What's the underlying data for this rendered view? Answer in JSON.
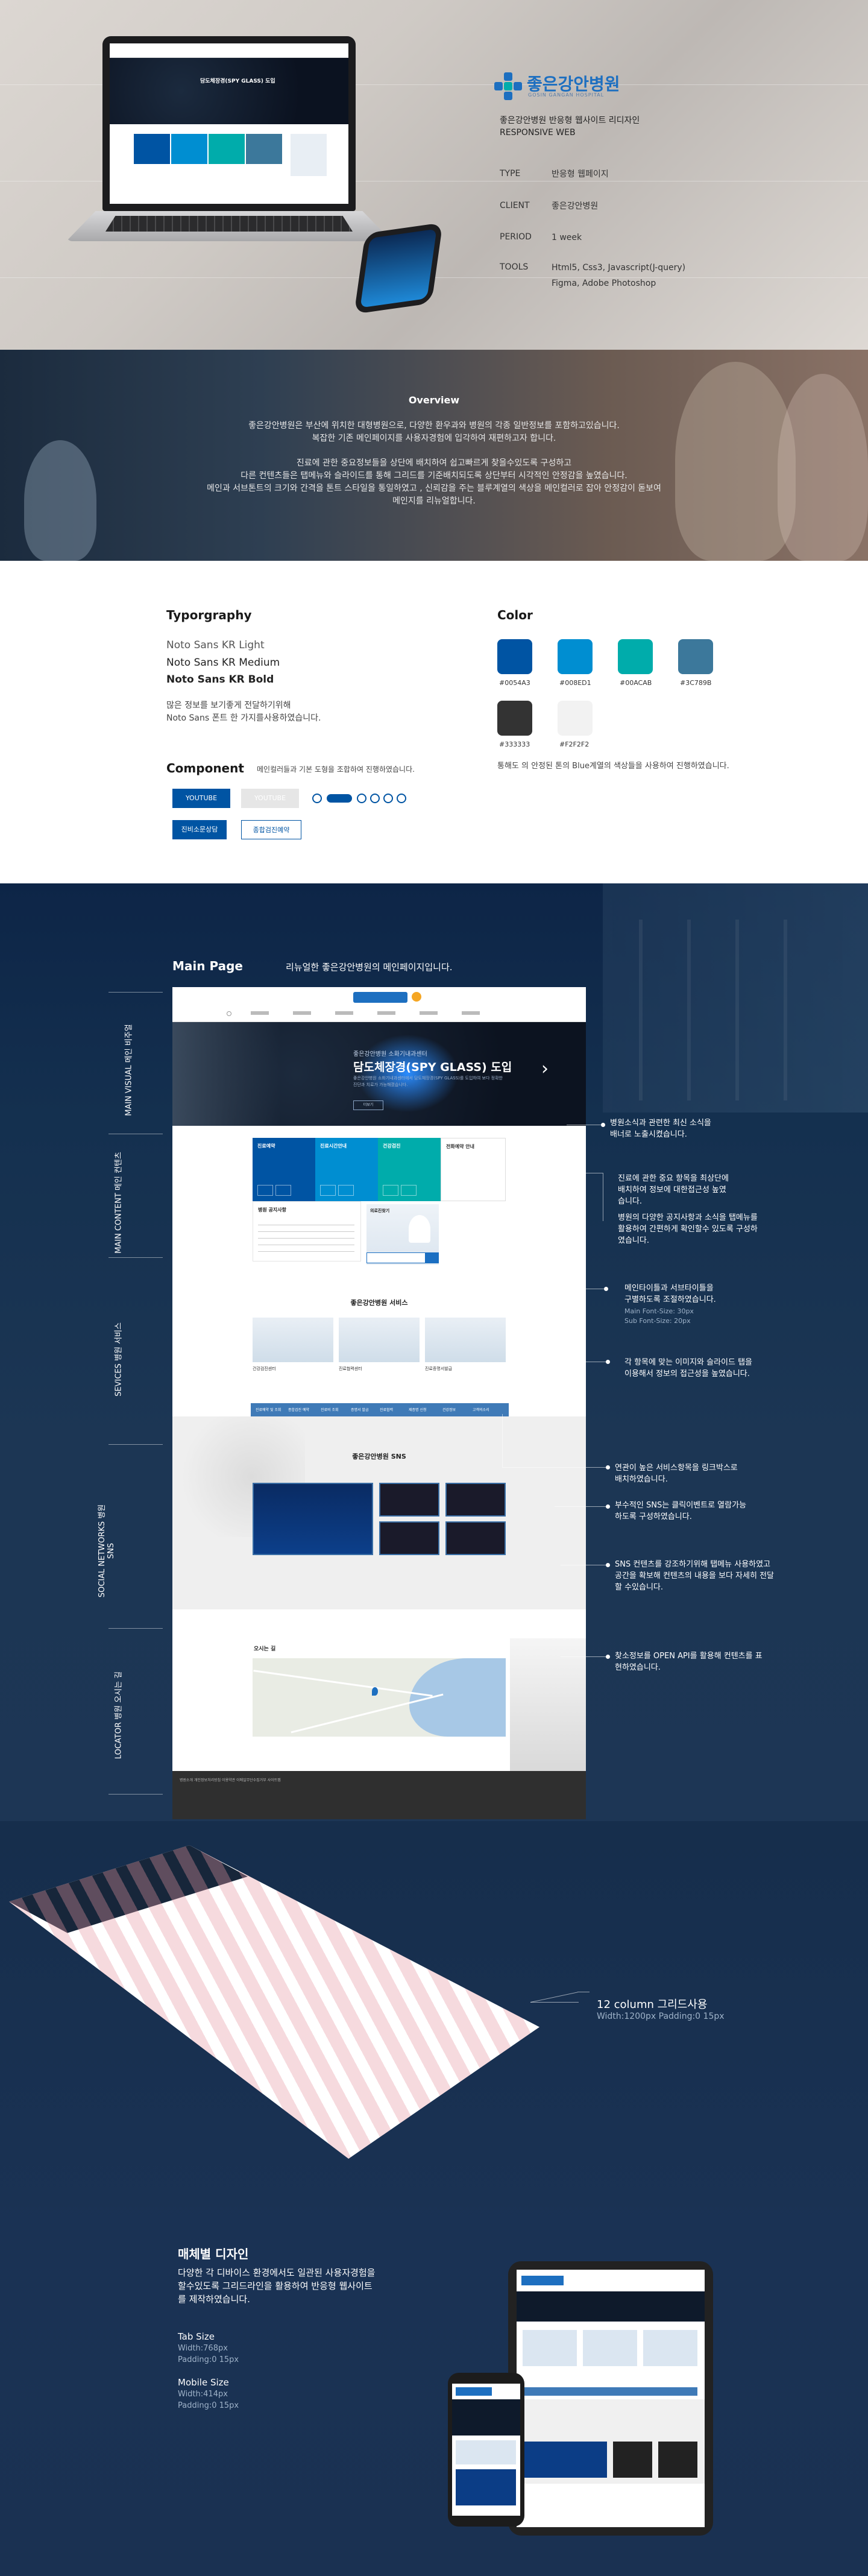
{
  "hero": {
    "brand_name": "좋은강안병원",
    "brand_sub": "GOSIN GANGAN HOSPITAL",
    "desc_line1": "좋은강안병원 반응형 웹사이트 리디자인",
    "desc_line2": "RESPONSIVE WEB",
    "info": [
      {
        "key": "TYPE",
        "value": "반응형 웹페이지"
      },
      {
        "key": "CLIENT",
        "value": "좋은강안병원"
      },
      {
        "key": "PERIOD",
        "value": "1 week"
      },
      {
        "key": "TOOLS",
        "value": "Html5, Css3, Javascript(J-query)",
        "value2": "Figma, Adobe Photoshop"
      }
    ],
    "laptop_slide_title": "담도체장경(SPY GLASS) 도입"
  },
  "overview": {
    "title": "Overview",
    "para1_l1": "좋은강안병원은 부산에 위치한 대형병원으로, 다양한 환우과와 병원의 각종 일반정보를 포함하고있습니다.",
    "para1_l2": "복잡한 기존 메인페이지를 사용자경험에 입각하여 재편하고자 합니다.",
    "para2_l1": "진료에 관한 중요정보들을 상단에 배치하여 쉽고빠르게 찾을수있도록 구성하고",
    "para2_l2": "다른 컨텐츠들은 탭메뉴와 슬라이드를 통해 그리드를 기준배치되도록 상단부터 시각적인 안정감을 높였습니다.",
    "para2_l3": "메인과 서브톤트의 크기와 간격을 톤트 스타일을 통일하였고 , 신뢰감을 주는 블루계열의 색상을 메인컬러로 잡아 안정감이 돋보여",
    "para2_l4": "메인지를 리뉴얼합니다."
  },
  "guide": {
    "typo_title": "Typorgraphy",
    "typo_light": "Noto Sans KR Light",
    "typo_medium": "Noto Sans KR Medium",
    "typo_bold": "Noto Sans KR Bold",
    "typo_desc_l1": "많은 정보를 보기좋게 전달하기위해",
    "typo_desc_l2": "Noto Sans 폰트 한 가지를사용하였습니다.",
    "color_title": "Color",
    "colors": [
      {
        "hex": "#0054A3",
        "label": "#0054A3"
      },
      {
        "hex": "#008ED1",
        "label": "#008ED1"
      },
      {
        "hex": "#00ACAB",
        "label": "#00ACAB"
      },
      {
        "hex": "#3C789B",
        "label": "#3C789B"
      },
      {
        "hex": "#333333",
        "label": "#333333"
      },
      {
        "hex": "#F2F2F2",
        "label": "#F2F2F2"
      }
    ],
    "color_desc": "통해도 의 안정된 톤의 Blue계열의 색상들을 사용하여 진행하였습니다.",
    "component_title": "Component",
    "component_desc": "메인컬러들과 기본 도형을 조합하여 진행하였습니다.",
    "btn_youtube": "YOUTUBE",
    "btn_gray": "YOUTUBE",
    "btn_blue2": "진비소문상담",
    "btn_outline": "종합검진예약"
  },
  "main": {
    "heading": "Main Page",
    "subheading": "리뉴얼한 좋은강안병원의 메인페이지입니다.",
    "side_labels": [
      {
        "en": "MAIN VISUAL",
        "ko": "메인 비주얼"
      },
      {
        "en": "MAIN CONTENT",
        "ko": "메인 컨텐츠"
      },
      {
        "en": "SEVICES",
        "ko": "병원 서비스"
      },
      {
        "en": "SOCIAL NETWORKS",
        "ko": "병원 SNS"
      },
      {
        "en": "LOCATOR",
        "ko": "병원 오시는 길"
      }
    ],
    "notes": {
      "n1_l1": "병원소식과 관련한 최신 소식을",
      "n1_l2": "배너로 노출시켰습니다.",
      "n2_l1": "진료에 관한 중요 항목을 최상단에",
      "n2_l2": "배치하여 정보에 대한접근성 높였",
      "n2_l3": "습니다.",
      "n3_l1": "병원의 다양한 공지사항과 소식을 탭메뉴를",
      "n3_l2": "활용하여 간편하게 확인할수 있도록 구성하",
      "n3_l3": "였습니다.",
      "n4_l1": "메인타이틀과 서브타이틀을",
      "n4_l2": "구별하도록 조절하였습니다.",
      "n4_l3": "Main Font-Size: 30px",
      "n4_l4": "Sub Font-Size: 20px",
      "n5_l1": "각 항목에 맞는 이미지와 슬라이드 탭을",
      "n5_l2": "이용해서 정보의 접근성을 높였습니다.",
      "n6_l1": "연관이 높은 서비스항목을 링크박스로",
      "n6_l2": "배치하였습니다.",
      "n7_l1": "부수적인 SNS는 클릭이벤트로 열람가능",
      "n7_l2": "하도록 구성하였습니다.",
      "n8_l1": "SNS 컨텐츠를 강조하기위해 탭메뉴 사용하였고",
      "n8_l2": "공간을 확보해 컨텐츠의 내용을 보다 자세히 전달",
      "n8_l3": "할 수있습니다.",
      "n9_l1": "찾소정보를 OPEN API를 활용해 컨텐츠를 표",
      "n9_l2": "현하였습니다."
    },
    "mock": {
      "slide_small": "좋은강안병원 소화기내과센터",
      "slide_title": "담도체장경(SPY GLASS) 도입",
      "slide_text": "좋은강안병원 소화기내과센터에서 담도체장경(SPY GLASS)를 도입하여 보다 정확한 진단과 치료가 가능해졌습니다.",
      "slide_more": "더보기",
      "quick": [
        "진료예약",
        "진료시간안내",
        "건강검진",
        "전화예약 안내"
      ],
      "notice_title": "병원 공지사항",
      "doctor_title": "의료진찾기",
      "services_title": "좋은강안병원 서비스",
      "cards": [
        "건강검진센터",
        "진료협력센터",
        "진료증명서발급"
      ],
      "tabbar": [
        "진료예약 및 조회",
        "종합검진 예약",
        "진료비 조회",
        "증명서 발급",
        "진료협력",
        "제증명 신청",
        "건강정보",
        "고객의소리"
      ],
      "sns_title": "좋은강안병원 SNS",
      "map_title": "오시는 길",
      "footer_links": "병원소개  개인정보처리방침  이용약관  이메일무단수집거부  사이트맵"
    }
  },
  "grid": {
    "title": "12 column 그리드사용",
    "sub": "Width:1200px Padding:0 15px"
  },
  "device": {
    "title": "매체별 디자인",
    "desc_l1": "다양한 각 디바이스 환경에서도 일관된 사용자경험을",
    "desc_l2": "할수있도록 그리드라인을 활용하여 반응형 웹사이트",
    "desc_l3": "를 제작하였습니다.",
    "tab_label": "Tab Size",
    "tab_w": "Width:768px",
    "tab_p": "Padding:0 15px",
    "mob_label": "Mobile Size",
    "mob_w": "Width:414px",
    "mob_p": "Padding:0 15px"
  }
}
